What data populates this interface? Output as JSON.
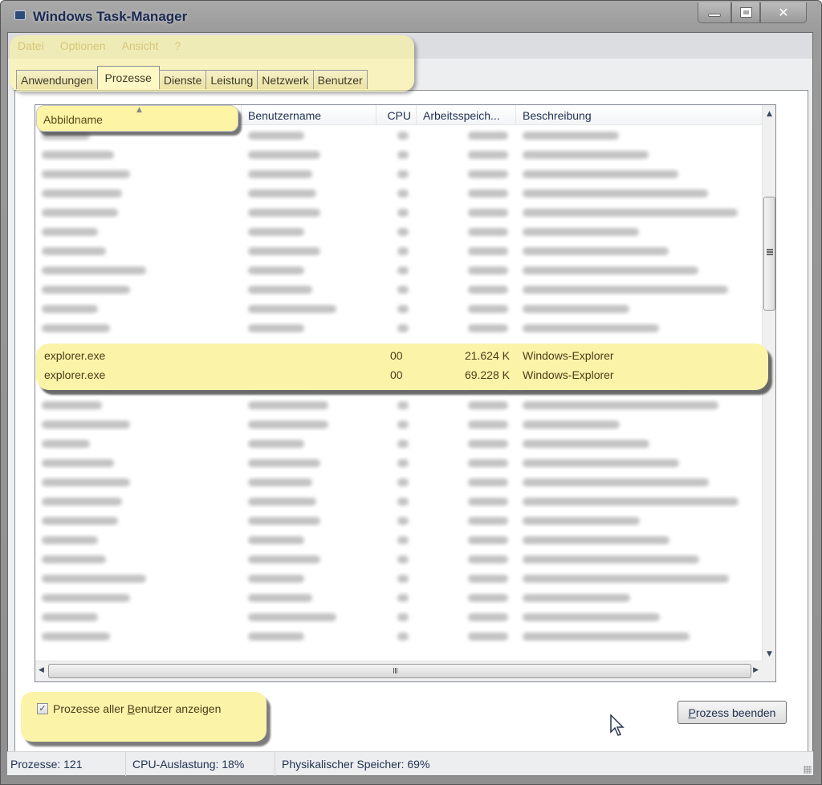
{
  "window": {
    "title": "Windows Task-Manager",
    "controls": {
      "minimize": "minimize",
      "maximize": "maximize",
      "close": "✕"
    }
  },
  "menu": [
    "Datei",
    "Optionen",
    "Ansicht",
    "?"
  ],
  "tabs": [
    {
      "label": "Anwendungen",
      "active": false
    },
    {
      "label": "Prozesse",
      "active": true
    },
    {
      "label": "Dienste",
      "active": false
    },
    {
      "label": "Leistung",
      "active": false
    },
    {
      "label": "Netzwerk",
      "active": false
    },
    {
      "label": "Benutzer",
      "active": false
    }
  ],
  "table": {
    "columns": [
      "Abbildname",
      "Benutzername",
      "CPU",
      "Arbeitsspeich...",
      "Beschreibung"
    ],
    "sorted_column": "Abbildname",
    "sort_direction": "ascending",
    "visible_rows": [
      {
        "name": "explorer.exe",
        "user": "",
        "cpu": "00",
        "memory": "21.624 K",
        "description": "Windows-Explorer"
      },
      {
        "name": "explorer.exe",
        "user": "",
        "cpu": "00",
        "memory": "69.228 K",
        "description": "Windows-Explorer"
      }
    ],
    "blurred_row_count_above": 11,
    "blurred_row_count_below": 14
  },
  "options": {
    "show_all_users_label_pre": "Prozesse aller ",
    "show_all_users_label_accel": "B",
    "show_all_users_label_post": "enutzer anzeigen",
    "show_all_users_checked": true,
    "end_process_accel": "P",
    "end_process_rest": "rozess beenden"
  },
  "status": {
    "processes": "Prozesse: 121",
    "cpu": "CPU-Auslastung: 18%",
    "memory": "Physikalischer Speicher: 69%"
  },
  "icons": {
    "sort_ascending": "▲",
    "scroll_up": "▲",
    "scroll_down": "▼",
    "scroll_left": "◀",
    "scroll_right": "▶",
    "checkmark": "✓",
    "hgrip": "III"
  },
  "colors": {
    "highlight": "#fbf3a8",
    "menu_text": "#a08f4e",
    "title_text": "#1b2a52"
  }
}
